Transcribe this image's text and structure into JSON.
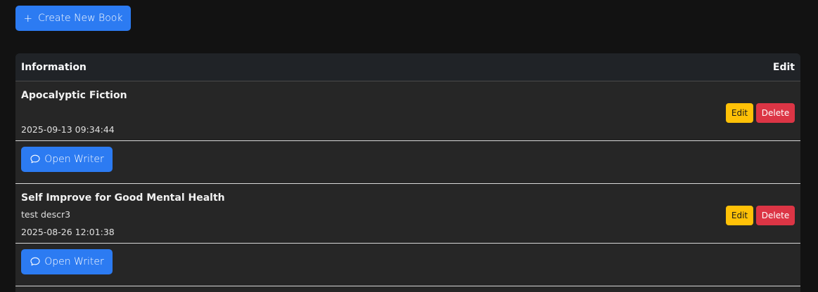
{
  "toolbar": {
    "create_icon": "plus-icon",
    "create_label": "Create New Book"
  },
  "table": {
    "headers": [
      "Information",
      "Edit"
    ],
    "rows": [
      {
        "title": "Apocalyptic Fiction",
        "description": "",
        "date": "2025-09-13 09:34:44",
        "edit_label": "Edit",
        "delete_label": "Delete",
        "open_writer_label": "Open Writer",
        "open_writer_icon": "chat-bubble-icon"
      },
      {
        "title": "Self Improve for Good Mental Health",
        "description": "test descr3",
        "date": "2025-08-26 12:01:38",
        "edit_label": "Edit",
        "delete_label": "Delete",
        "open_writer_label": "Open Writer",
        "open_writer_icon": "chat-bubble-icon"
      }
    ]
  },
  "colors": {
    "background": "#121212",
    "primary": "#2c7bf2",
    "warning": "#ffc107",
    "danger": "#dc3545"
  }
}
